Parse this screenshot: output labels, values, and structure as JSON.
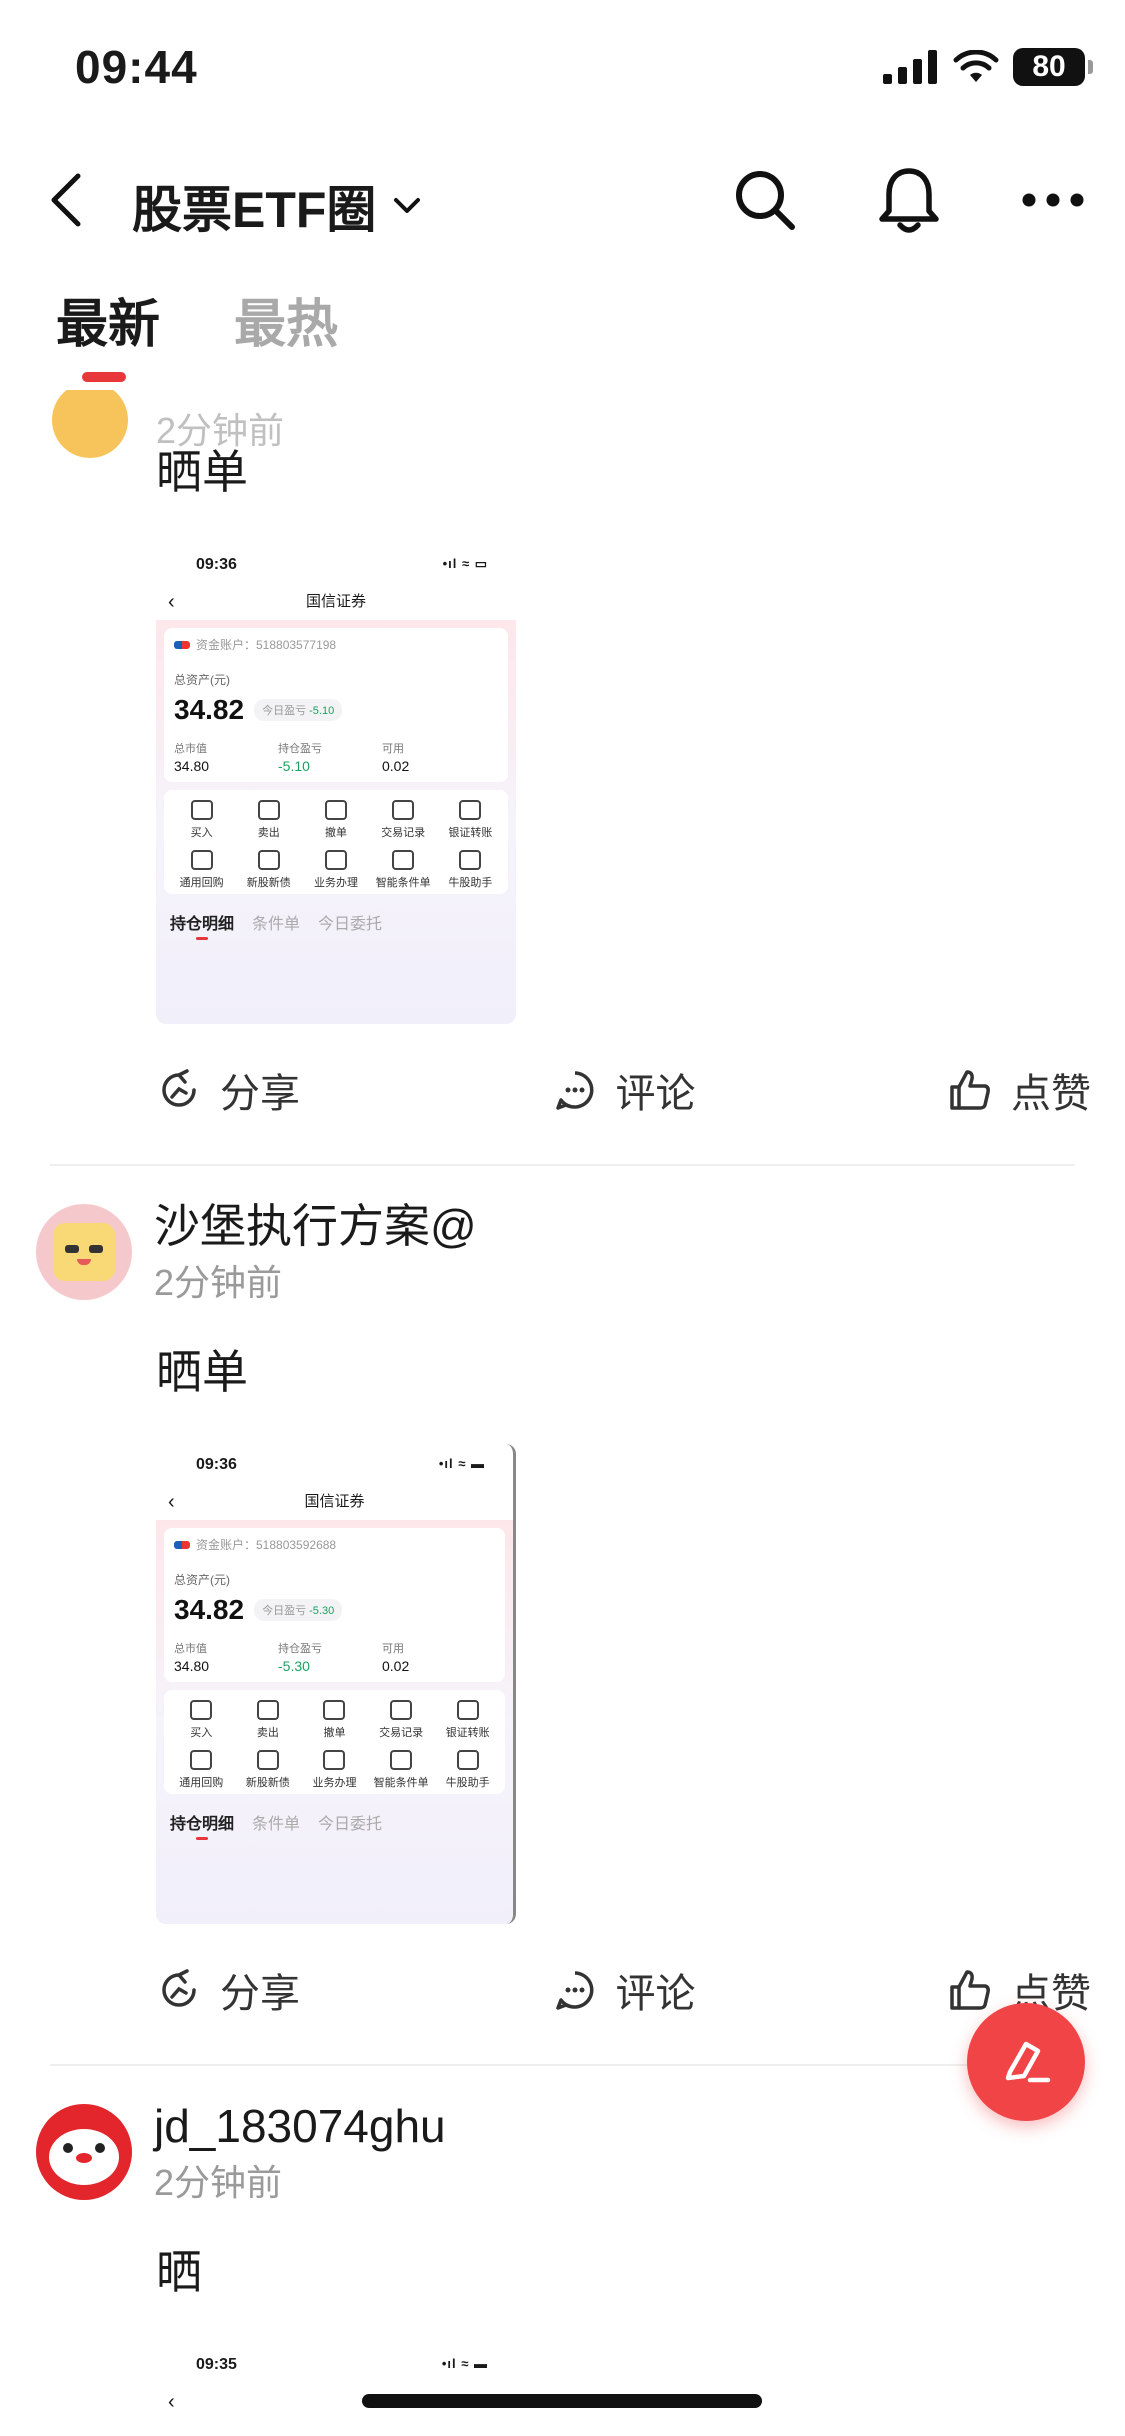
{
  "status_bar": {
    "time": "09:44",
    "battery": "80"
  },
  "nav": {
    "title": "股票ETF圈"
  },
  "tabs": [
    {
      "label": "最新"
    },
    {
      "label": "最热"
    }
  ],
  "posts": [
    {
      "author": "",
      "time": "2分钟前",
      "text": "晒单",
      "shot": {
        "time": "09:36",
        "title": "国信证券",
        "account": "资金账户：518803577198",
        "asset_label": "总资产(元)",
        "asset_value": "34.82",
        "pnl_label": "今日盈亏",
        "pnl_value": "-5.10",
        "stats": [
          {
            "k": "总市值",
            "v": "34.80"
          },
          {
            "k": "持仓盈亏",
            "v": "-5.10"
          },
          {
            "k": "可用",
            "v": "0.02"
          }
        ],
        "menu": [
          "买入",
          "卖出",
          "撤单",
          "交易记录",
          "银证转账",
          "通用回购",
          "新股新债",
          "业务办理",
          "智能条件单",
          "牛股助手"
        ],
        "sub_tabs": [
          "持仓明细",
          "条件单",
          "今日委托"
        ]
      },
      "actions": {
        "share": "分享",
        "comment": "评论",
        "like": "点赞"
      }
    },
    {
      "author": "沙堡执行方案@",
      "time": "2分钟前",
      "text": "晒单",
      "shot": {
        "time": "09:36",
        "title": "国信证券",
        "account": "资金账户：518803592688",
        "asset_label": "总资产(元)",
        "asset_value": "34.82",
        "pnl_label": "今日盈亏",
        "pnl_value": "-5.30",
        "stats": [
          {
            "k": "总市值",
            "v": "34.80"
          },
          {
            "k": "持仓盈亏",
            "v": "-5.30"
          },
          {
            "k": "可用",
            "v": "0.02"
          }
        ],
        "menu": [
          "买入",
          "卖出",
          "撤单",
          "交易记录",
          "银证转账",
          "通用回购",
          "新股新债",
          "业务办理",
          "智能条件单",
          "牛股助手"
        ],
        "sub_tabs": [
          "持仓明细",
          "条件单",
          "今日委托"
        ]
      },
      "actions": {
        "share": "分享",
        "comment": "评论",
        "like": "点赞"
      }
    },
    {
      "author": "jd_183074ghu",
      "time": "2分钟前",
      "text": "晒",
      "shot": {
        "time": "09:35"
      }
    }
  ],
  "colors": {
    "accent": "#e8373b",
    "fab": "#f04447",
    "gain": "#1aa260"
  }
}
